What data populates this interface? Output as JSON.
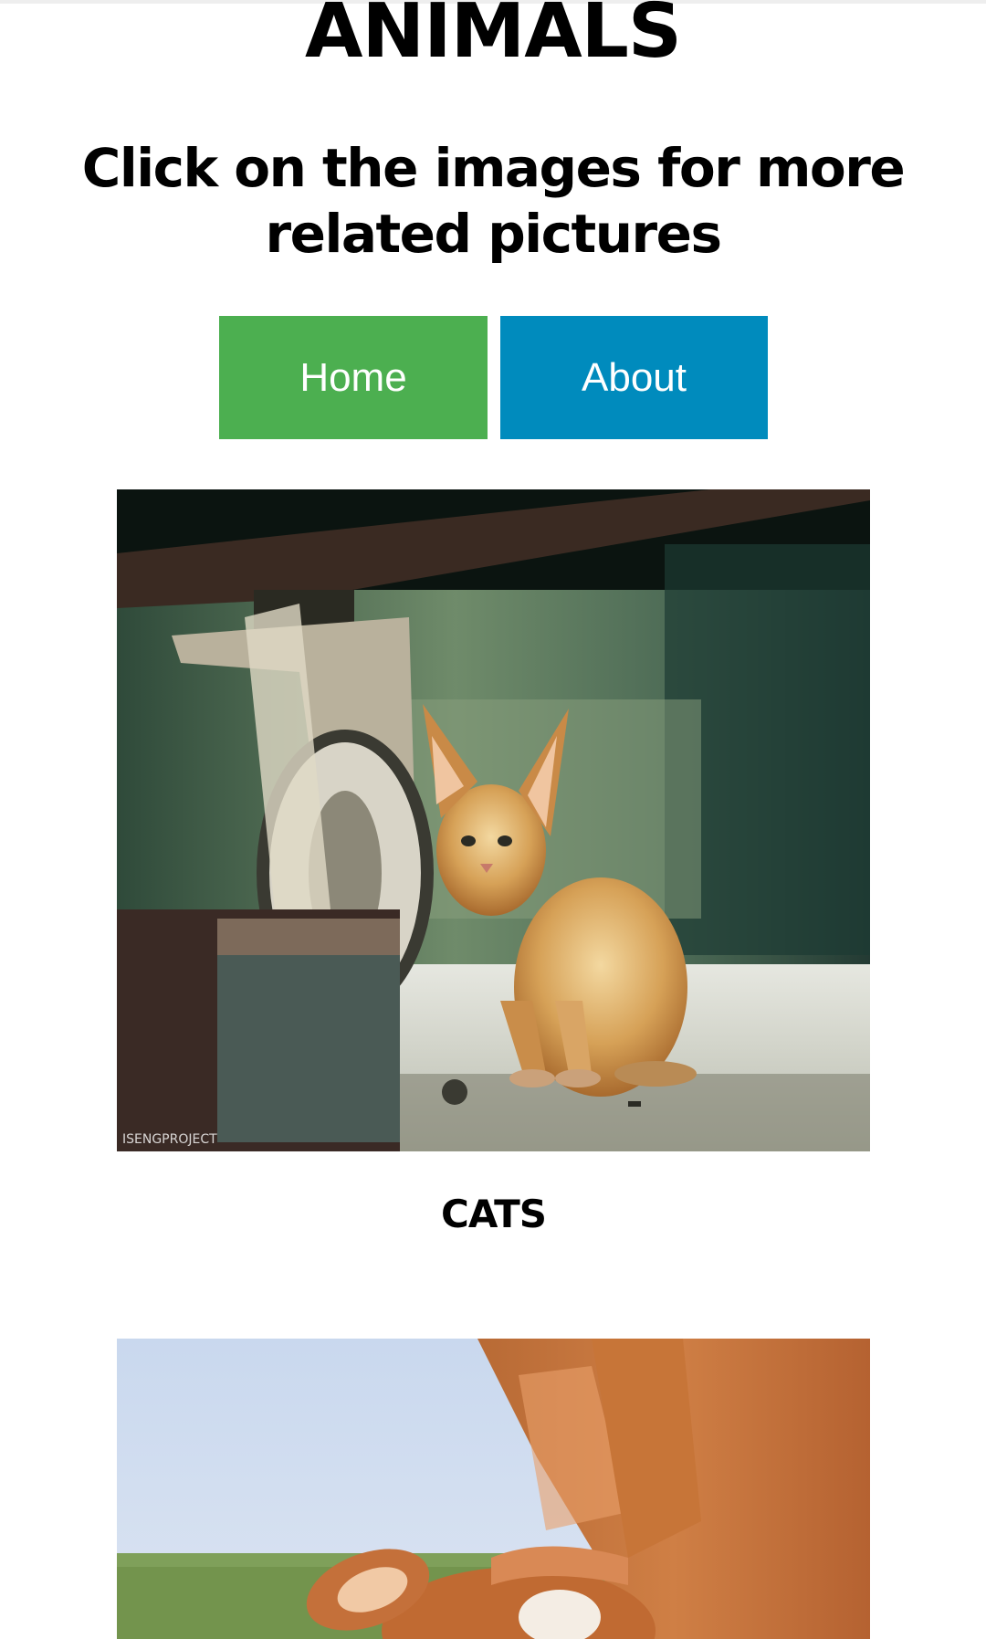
{
  "page": {
    "title": "ANIMALS",
    "subtitle": "Click on the images for more related pictures"
  },
  "nav": {
    "home_label": "Home",
    "about_label": "About",
    "home_color": "#4caf50",
    "about_color": "#008bbd"
  },
  "gallery": [
    {
      "caption": "CATS",
      "image": "kitten-photo",
      "watermark": "ISENGPROJECT"
    },
    {
      "caption": "",
      "image": "cow-photo"
    }
  ]
}
